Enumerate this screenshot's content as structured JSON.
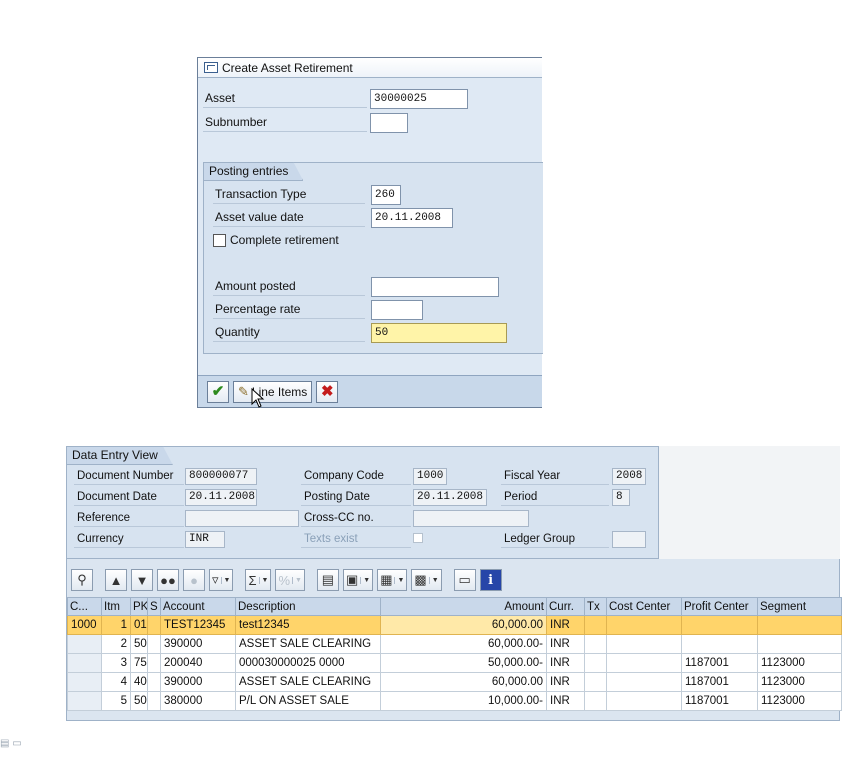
{
  "dialog": {
    "title": "Create Asset Retirement",
    "asset_label": "Asset",
    "asset_value": "30000025",
    "subnumber_label": "Subnumber",
    "subnumber_value": "",
    "group_title": "Posting entries",
    "transaction_type_label": "Transaction Type",
    "transaction_type_value": "260",
    "asset_value_date_label": "Asset value date",
    "asset_value_date_value": "20.11.2008",
    "complete_retirement_label": "Complete retirement",
    "amount_posted_label": "Amount posted",
    "amount_posted_value": "",
    "percentage_rate_label": "Percentage rate",
    "percentage_rate_value": "",
    "quantity_label": "Quantity",
    "quantity_value": "50",
    "line_items_label": "Line Items"
  },
  "data_entry": {
    "title": "Data Entry View",
    "doc_number_label": "Document Number",
    "doc_number_value": "800000077",
    "company_code_label": "Company Code",
    "company_code_value": "1000",
    "fiscal_year_label": "Fiscal Year",
    "fiscal_year_value": "2008",
    "doc_date_label": "Document Date",
    "doc_date_value": "20.11.2008",
    "posting_date_label": "Posting Date",
    "posting_date_value": "20.11.2008",
    "period_label": "Period",
    "period_value": "8",
    "reference_label": "Reference",
    "cross_cc_label": "Cross-CC no.",
    "currency_label": "Currency",
    "currency_value": "INR",
    "texts_exist_label": "Texts exist",
    "ledger_group_label": "Ledger Group"
  },
  "grid": {
    "columns": [
      "C...",
      "Itm",
      "PK",
      "S",
      "Account",
      "Description",
      "Amount",
      "Curr.",
      "Tx",
      "Cost Center",
      "Profit Center",
      "Segment"
    ],
    "rows": [
      {
        "c": "1000",
        "itm": "1",
        "pk": "01",
        "s": "",
        "account": "TEST12345",
        "desc": "test12345",
        "amount": "60,000.00",
        "curr": "INR",
        "tx": "",
        "cost": "",
        "profit": "",
        "segment": ""
      },
      {
        "c": "",
        "itm": "2",
        "pk": "50",
        "s": "",
        "account": "390000",
        "desc": "ASSET SALE CLEARING",
        "amount": "60,000.00-",
        "curr": "INR",
        "tx": "",
        "cost": "",
        "profit": "",
        "segment": ""
      },
      {
        "c": "",
        "itm": "3",
        "pk": "75",
        "s": "",
        "account": "200040",
        "desc": "000030000025 0000",
        "amount": "50,000.00-",
        "curr": "INR",
        "tx": "",
        "cost": "",
        "profit": "1187001",
        "segment": "1123000"
      },
      {
        "c": "",
        "itm": "4",
        "pk": "40",
        "s": "",
        "account": "390000",
        "desc": "ASSET SALE CLEARING",
        "amount": "60,000.00",
        "curr": "INR",
        "tx": "",
        "cost": "",
        "profit": "1187001",
        "segment": "1123000"
      },
      {
        "c": "",
        "itm": "5",
        "pk": "50",
        "s": "",
        "account": "380000",
        "desc": "P/L ON ASSET SALE",
        "amount": "10,000.00-",
        "curr": "INR",
        "tx": "",
        "cost": "",
        "profit": "1187001",
        "segment": "1123000"
      }
    ]
  },
  "icons": {
    "title": "window-icon",
    "confirm": "check-icon",
    "line_items": "pencil-icon",
    "cancel": "cancel-x-icon",
    "info": "info-icon"
  },
  "colors": {
    "selected_row": "#ffd46a",
    "required_field": "#fff4a8",
    "panel": "#d7e3f0"
  }
}
